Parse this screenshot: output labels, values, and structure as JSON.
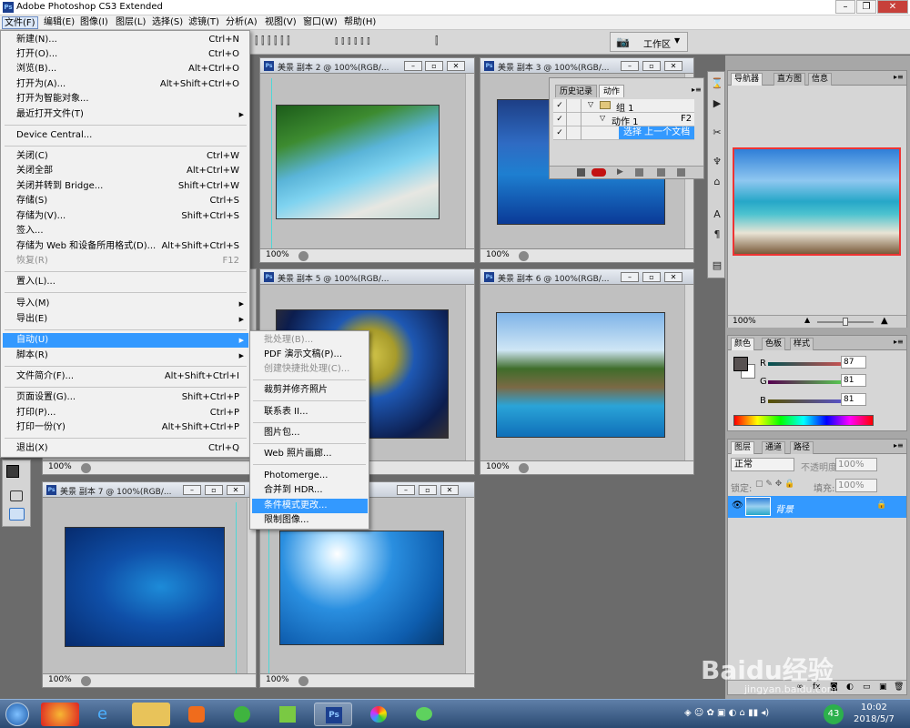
{
  "app": {
    "title": "Adobe Photoshop CS3 Extended"
  },
  "menubar": [
    "文件(F)",
    "编辑(E)",
    "图像(I)",
    "图层(L)",
    "选择(S)",
    "滤镜(T)",
    "分析(A)",
    "视图(V)",
    "窗口(W)",
    "帮助(H)"
  ],
  "workspace": {
    "label": "工作区"
  },
  "file_menu": {
    "new": {
      "label": "新建(N)...",
      "shortcut": "Ctrl+N"
    },
    "open": {
      "label": "打开(O)...",
      "shortcut": "Ctrl+O"
    },
    "browse": {
      "label": "浏览(B)...",
      "shortcut": "Alt+Ctrl+O"
    },
    "open_as": {
      "label": "打开为(A)...",
      "shortcut": "Alt+Shift+Ctrl+O"
    },
    "open_smart": {
      "label": "打开为智能对象..."
    },
    "recent": {
      "label": "最近打开文件(T)"
    },
    "device_central": {
      "label": "Device Central..."
    },
    "close": {
      "label": "关闭(C)",
      "shortcut": "Ctrl+W"
    },
    "close_all": {
      "label": "关闭全部",
      "shortcut": "Alt+Ctrl+W"
    },
    "close_bridge": {
      "label": "关闭并转到 Bridge...",
      "shortcut": "Shift+Ctrl+W"
    },
    "save": {
      "label": "存储(S)",
      "shortcut": "Ctrl+S"
    },
    "save_as": {
      "label": "存储为(V)...",
      "shortcut": "Shift+Ctrl+S"
    },
    "check_in": {
      "label": "签入..."
    },
    "save_web": {
      "label": "存储为 Web 和设备所用格式(D)...",
      "shortcut": "Alt+Shift+Ctrl+S"
    },
    "revert": {
      "label": "恢复(R)",
      "shortcut": "F12"
    },
    "place": {
      "label": "置入(L)..."
    },
    "import": {
      "label": "导入(M)"
    },
    "export": {
      "label": "导出(E)"
    },
    "automate": {
      "label": "自动(U)"
    },
    "scripts": {
      "label": "脚本(R)"
    },
    "file_info": {
      "label": "文件简介(F)...",
      "shortcut": "Alt+Shift+Ctrl+I"
    },
    "page_setup": {
      "label": "页面设置(G)...",
      "shortcut": "Shift+Ctrl+P"
    },
    "print": {
      "label": "打印(P)...",
      "shortcut": "Ctrl+P"
    },
    "print_one": {
      "label": "打印一份(Y)",
      "shortcut": "Alt+Shift+Ctrl+P"
    },
    "exit": {
      "label": "退出(X)",
      "shortcut": "Ctrl+Q"
    }
  },
  "automate_submenu": [
    "批处理(B)...",
    "PDF 演示文稿(P)...",
    "创建快捷批处理(C)...",
    "裁剪并修齐照片",
    "联系表 II...",
    "图片包...",
    "Web 照片画廊...",
    "Photomerge...",
    "合并到 HDR...",
    "条件模式更改...",
    "限制图像..."
  ],
  "documents": [
    {
      "title": "美景  副本 2 @ 100%(RGB/...",
      "zoom": "100%"
    },
    {
      "title": "美景  副本 3 @ 100%(RGB/...",
      "zoom": "100%"
    },
    {
      "title": "美景  副本 5 @ 100%(RGB/...",
      "zoom": "100%"
    },
    {
      "title": "美景  副本 6 @ 100%(RGB/...",
      "zoom": "100%"
    },
    {
      "title": "美景  副本 7 @ 100%(RGB/...",
      "zoom": "100%"
    },
    {
      "title": "",
      "zoom": "100%"
    },
    {
      "title": "",
      "zoom": "100%"
    }
  ],
  "actions_panel": {
    "tabs": [
      "历史记录",
      "动作"
    ],
    "group": "组 1",
    "action": "动作 1",
    "action_key": "F2",
    "step": "选择 上一个文档"
  },
  "navigator": {
    "tabs": [
      "导航器",
      "直方图",
      "信息"
    ],
    "zoom": "100%"
  },
  "color_panel": {
    "tabs": [
      "颜色",
      "色板",
      "样式"
    ],
    "r_label": "R",
    "g_label": "G",
    "b_label": "B",
    "r": "87",
    "g": "81",
    "b": "81"
  },
  "layers_panel": {
    "tabs": [
      "图层",
      "通道",
      "路径"
    ],
    "blend_mode": "正常",
    "opacity_label": "不透明度:",
    "opacity": "100%",
    "lock_label": "锁定:",
    "fill_label": "填充:",
    "fill": "100%",
    "layer_name": "背景"
  },
  "taskbar": {
    "time": "10:02",
    "date": "2018/5/7",
    "badge": "43"
  },
  "watermark": {
    "text": "Baidu经验",
    "url": "jingyan.baidu.com"
  }
}
